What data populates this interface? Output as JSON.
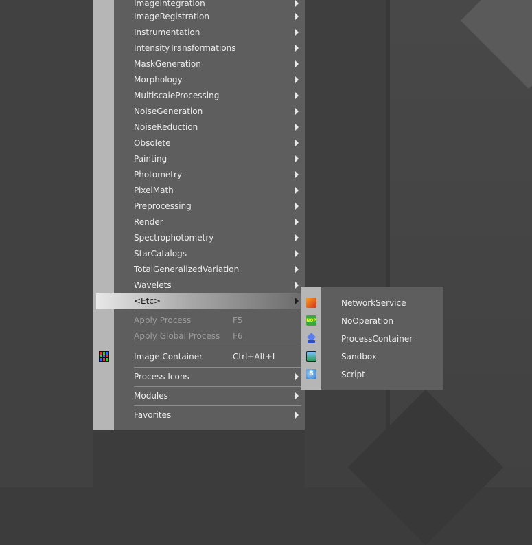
{
  "menu": {
    "submenu_items": [
      {
        "label": "ImageIntegration"
      },
      {
        "label": "ImageRegistration"
      },
      {
        "label": "Instrumentation"
      },
      {
        "label": "IntensityTransformations"
      },
      {
        "label": "MaskGeneration"
      },
      {
        "label": "Morphology"
      },
      {
        "label": "MultiscaleProcessing"
      },
      {
        "label": "NoiseGeneration"
      },
      {
        "label": "NoiseReduction"
      },
      {
        "label": "Obsolete"
      },
      {
        "label": "Painting"
      },
      {
        "label": "Photometry"
      },
      {
        "label": "PixelMath"
      },
      {
        "label": "Preprocessing"
      },
      {
        "label": "Render"
      },
      {
        "label": "Spectrophotometry"
      },
      {
        "label": "StarCatalogs"
      },
      {
        "label": "TotalGeneralizedVariation"
      },
      {
        "label": "Wavelets"
      }
    ],
    "etc_label": "<Etc>",
    "apply_process": {
      "label": "Apply Process",
      "shortcut": "F5"
    },
    "apply_global_process": {
      "label": "Apply Global Process",
      "shortcut": "F6"
    },
    "image_container": {
      "label": "Image Container",
      "shortcut": "Ctrl+Alt+I",
      "icon": "image-container-grid-icon"
    },
    "process_icons": {
      "label": "Process Icons"
    },
    "modules": {
      "label": "Modules"
    },
    "favorites": {
      "label": "Favorites"
    }
  },
  "etc_submenu": {
    "items": [
      {
        "label": "NetworkService",
        "icon": "network-service-icon"
      },
      {
        "label": "NoOperation",
        "icon": "no-operation-icon",
        "icon_text": "NOP"
      },
      {
        "label": "ProcessContainer",
        "icon": "process-container-icon"
      },
      {
        "label": "Sandbox",
        "icon": "sandbox-icon"
      },
      {
        "label": "Script",
        "icon": "script-icon",
        "icon_text": "S"
      }
    ]
  },
  "colors": {
    "menu_bg": "#5e5e5e",
    "gutter": "#b6b6b6",
    "text": "#ebebeb",
    "disabled_text": "#9c9c9c",
    "highlight_start": "#e8e8e8"
  }
}
